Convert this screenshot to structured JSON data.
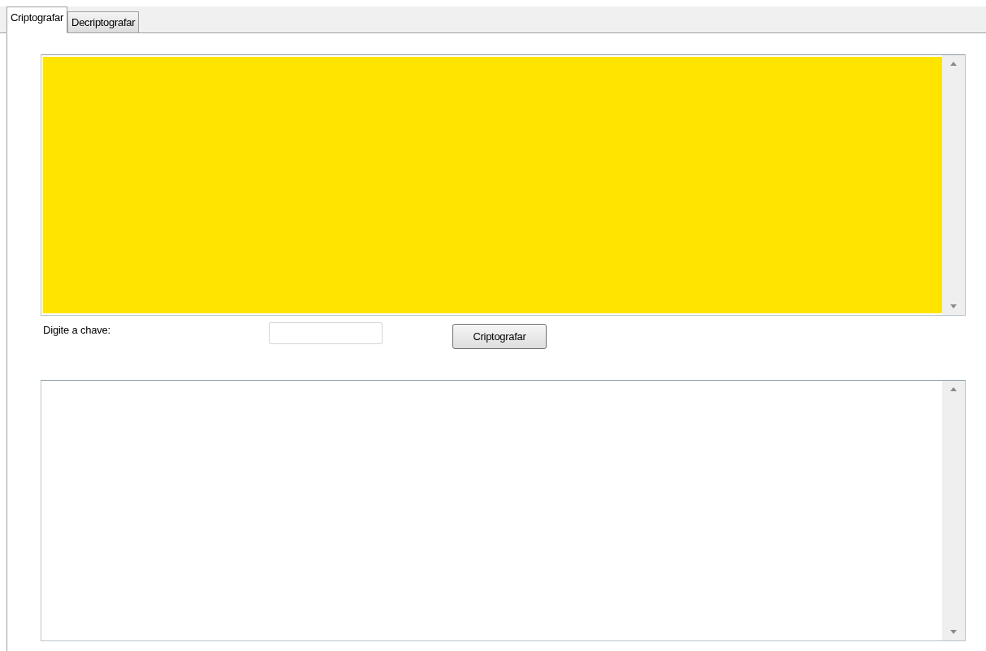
{
  "tabs": [
    {
      "label": "Criptografar",
      "selected": true
    },
    {
      "label": "Decriptografar",
      "selected": false
    }
  ],
  "key_label": "Digite a chave:",
  "encrypt_button": "Criptografar"
}
